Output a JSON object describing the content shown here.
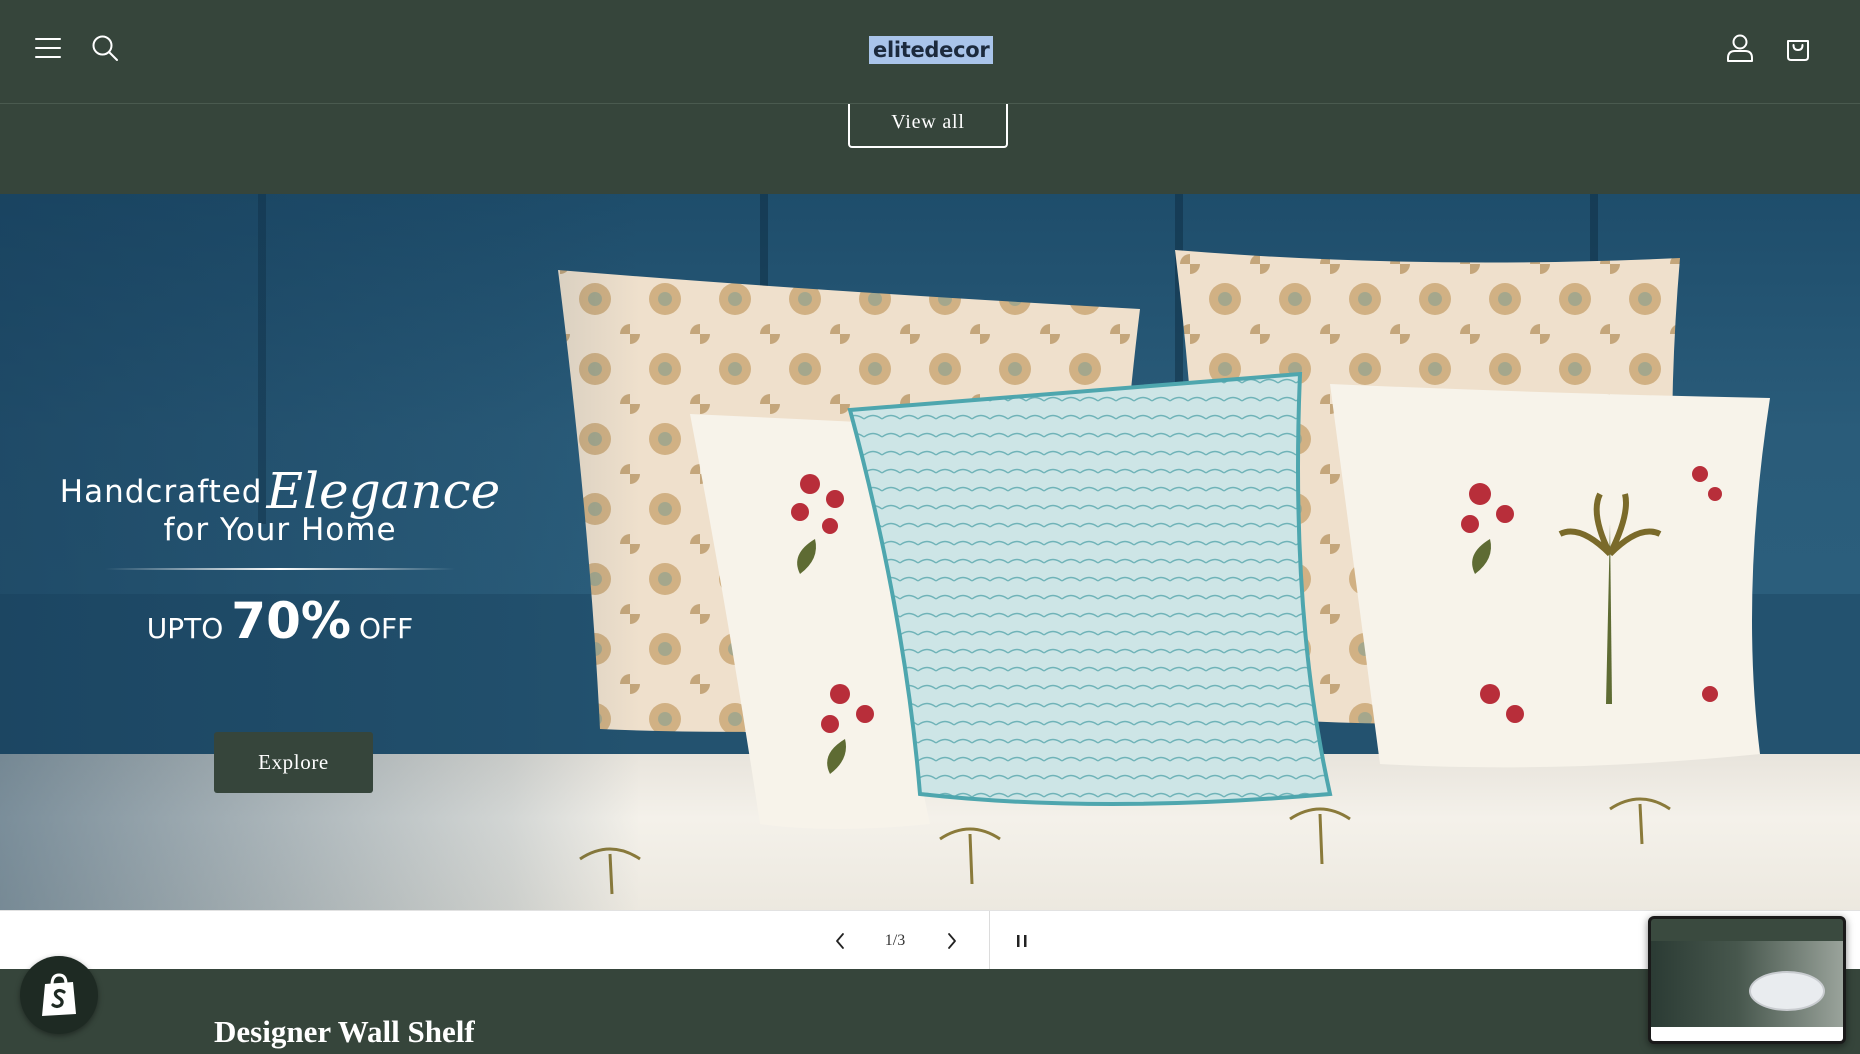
{
  "header": {
    "logo_text": "elitedecor",
    "menu_icon": "hamburger-menu-icon",
    "search_icon": "search-icon",
    "account_icon": "user-account-icon",
    "cart_icon": "shopping-bag-icon"
  },
  "collection": {
    "view_all_label": "View all"
  },
  "hero": {
    "line1": "Handcrafted",
    "script_word": "Elegance",
    "line2": "for Your Home",
    "offer_prefix": "UPTO",
    "offer_value": "70%",
    "offer_suffix": "OFF",
    "cta_label": "Explore"
  },
  "slider": {
    "counter": "1/3",
    "prev_icon": "chevron-left-icon",
    "next_icon": "chevron-right-icon",
    "pause_icon": "pause-icon"
  },
  "next_section": {
    "title": "Designer Wall Shelf"
  },
  "badges": {
    "shop_icon": "shopify-bag-icon"
  },
  "colors": {
    "brand_green": "#36453b",
    "headboard_blue": "#23526f",
    "logo_bg": "#a9c4ea"
  }
}
